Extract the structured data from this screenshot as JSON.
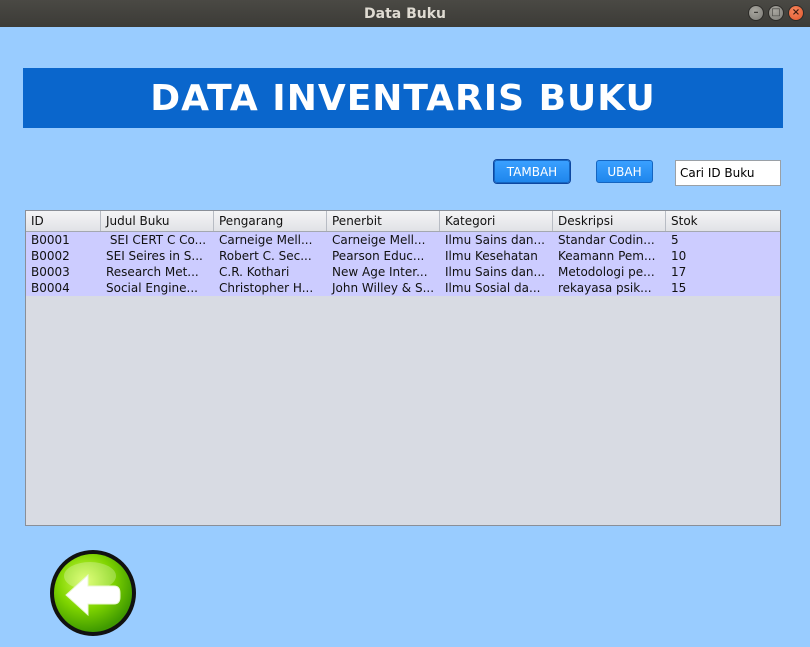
{
  "window": {
    "title": "Data Buku"
  },
  "banner": {
    "title": "DATA INVENTARIS BUKU"
  },
  "toolbar": {
    "tambah_label": "TAMBAH",
    "ubah_label": "UBAH",
    "search_value": "Cari ID Buku"
  },
  "table": {
    "headers": [
      "ID",
      "Judul Buku",
      "Pengarang",
      "Penerbit",
      "Kategori",
      "Deskripsi",
      "Stok"
    ],
    "rows": [
      [
        "B0001",
        " SEI CERT C Co...",
        "Carneige Mell...",
        "Carneige Mell...",
        "Ilmu Sains dan...",
        "Standar Codin...",
        "5"
      ],
      [
        "B0002",
        "SEI Seires in S...",
        "Robert C. Sec...",
        "Pearson Educ...",
        "Ilmu Kesehatan",
        "Keamann Pem...",
        "10"
      ],
      [
        "B0003",
        "Research Met...",
        "C.R. Kothari",
        "New Age Inter...",
        "Ilmu Sains dan...",
        "Metodologi pe...",
        "17"
      ],
      [
        "B0004",
        "Social Engine...",
        "Christopher H...",
        "John Willey & S...",
        "Ilmu Sosial da...",
        "rekayasa psik...",
        "15"
      ]
    ]
  },
  "colors": {
    "background": "#99ccff",
    "banner": "#0a66cc",
    "row_highlight": "#ccccff",
    "back_button": "#66cc00"
  },
  "icons": {
    "back": "arrow-left-icon"
  }
}
